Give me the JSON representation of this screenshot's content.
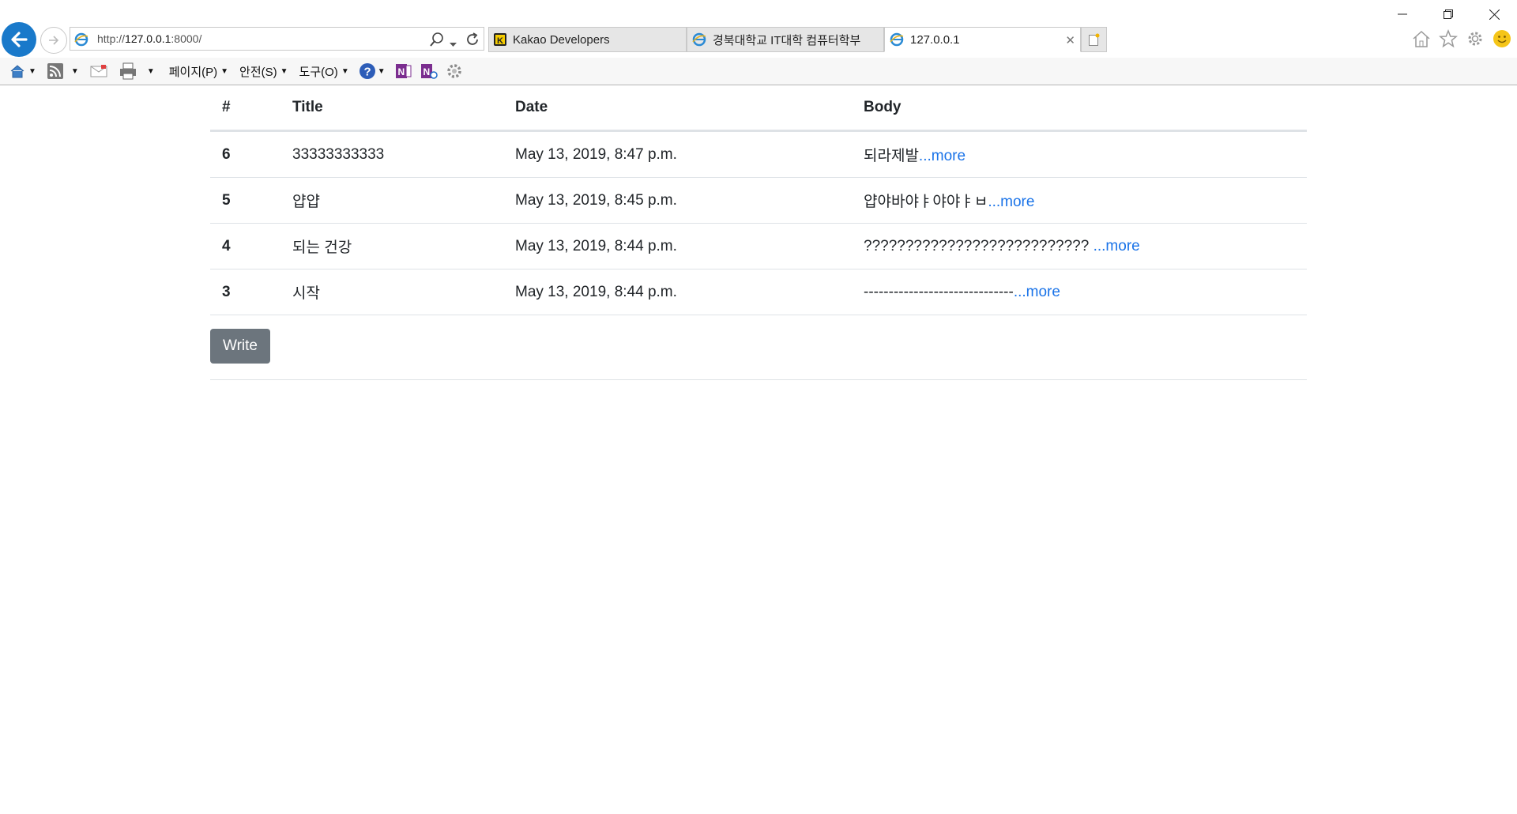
{
  "browser": {
    "url_scheme": "http://",
    "url_host": "127.0.0.1",
    "url_rest": ":8000/",
    "tabs": [
      {
        "label": "Kakao Developers"
      },
      {
        "label": "경북대학교 IT대학 컴퓨터학부"
      },
      {
        "label": "127.0.0.1"
      }
    ],
    "close_tab_glyph": "✕",
    "toolbar": {
      "page_menu": "페이지(P)",
      "safety_menu": "안전(S)",
      "tools_menu": "도구(O)"
    }
  },
  "table": {
    "headers": [
      "#",
      "Title",
      "Date",
      "Body"
    ],
    "rows": [
      {
        "num": "6",
        "title": "33333333333",
        "date": "May 13, 2019, 8:47 p.m.",
        "body": "되라제발",
        "more": "...more"
      },
      {
        "num": "5",
        "title": "얍얍",
        "date": "May 13, 2019, 8:45 p.m.",
        "body": "얍야바야ㅑ야야ㅑㅂ",
        "more": "...more"
      },
      {
        "num": "4",
        "title": "되는 건강",
        "date": "May 13, 2019, 8:44 p.m.",
        "body": "??????????????????????????? ",
        "more": "...more"
      },
      {
        "num": "3",
        "title": "시작",
        "date": "May 13, 2019, 8:44 p.m.",
        "body": "------------------------------",
        "more": "...more"
      }
    ]
  },
  "write_button": "Write",
  "icons": {
    "back": "back-arrow-icon",
    "forward": "forward-arrow-icon",
    "home": "home-icon",
    "favorites": "star-icon",
    "settings": "gear-icon",
    "feedback": "smiley-icon"
  },
  "colors": {
    "accent": "#1979ca",
    "link": "#1a73e8",
    "button": "#6c757d"
  }
}
